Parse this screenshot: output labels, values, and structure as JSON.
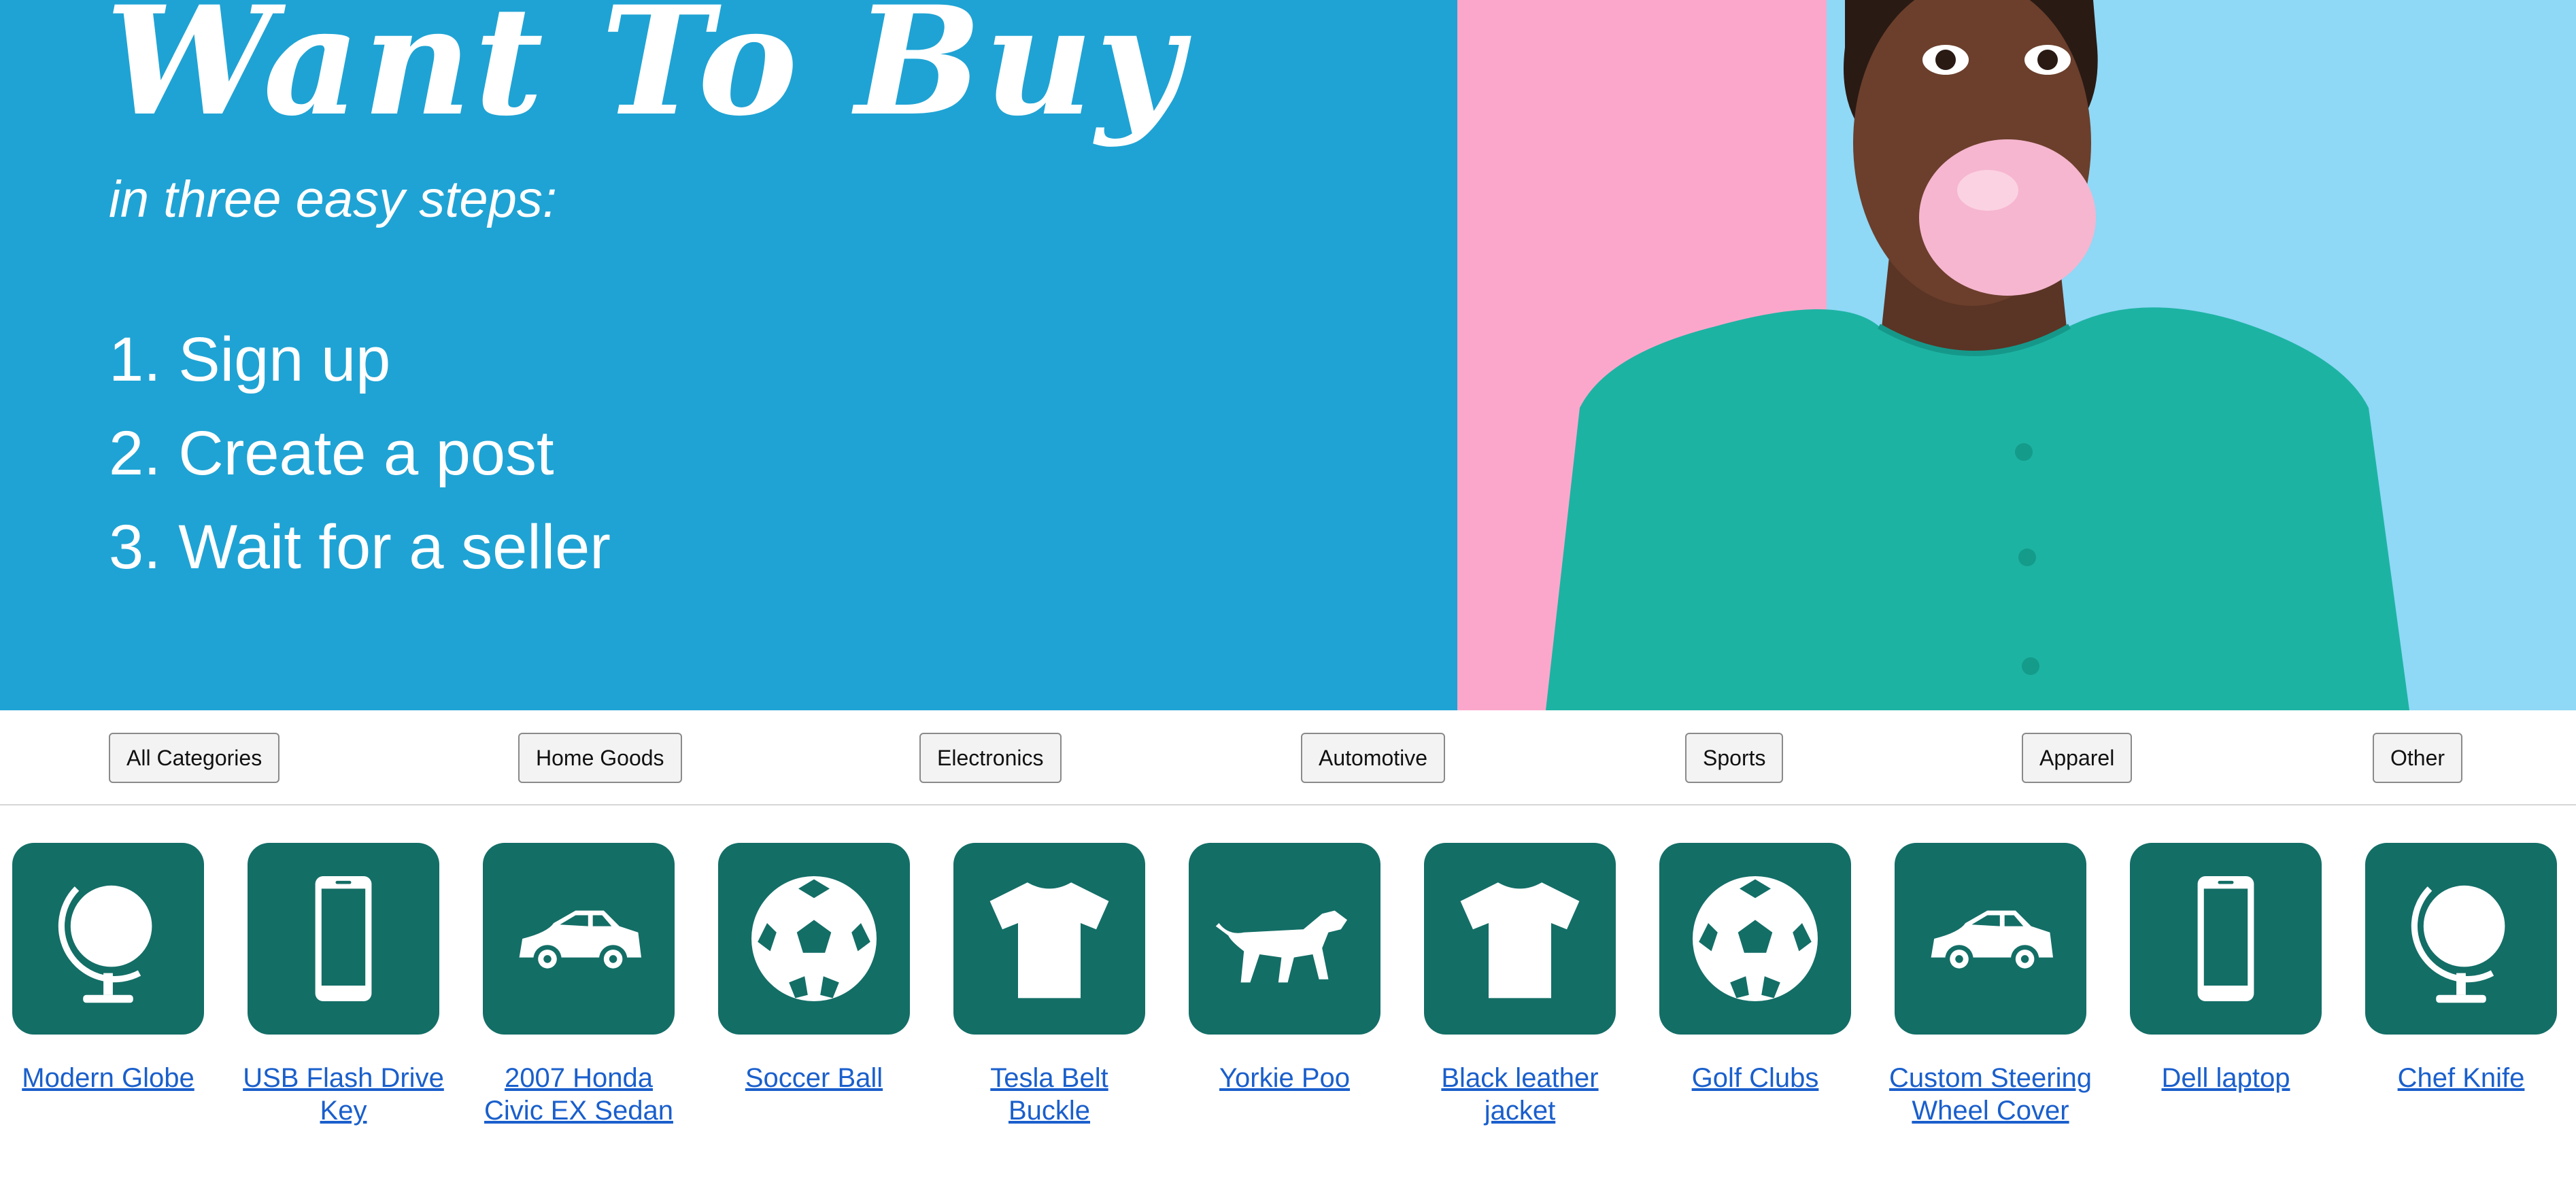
{
  "hero": {
    "title": "Want To Buy",
    "subtitle": "in three easy steps:",
    "steps": [
      "1.  Sign up",
      "2. Create a post",
      "3. Wait for a seller"
    ],
    "colors": {
      "left_bg": "#1fa3d4",
      "pink": "#fba7cb",
      "sky": "#8fd8f6",
      "cardigan": "#1db3a3"
    }
  },
  "categories": [
    "All Categories",
    "Home Goods",
    "Electronics",
    "Automotive",
    "Sports",
    "Apparel",
    "Other"
  ],
  "products": [
    {
      "icon": "globe-icon",
      "label": "Modern Globe"
    },
    {
      "icon": "phone-icon",
      "label": "USB Flash Drive Key"
    },
    {
      "icon": "car-icon",
      "label": "2007 Honda Civic EX Sedan"
    },
    {
      "icon": "soccer-ball-icon",
      "label": "Soccer Ball"
    },
    {
      "icon": "tshirt-icon",
      "label": "Tesla Belt Buckle"
    },
    {
      "icon": "dog-icon",
      "label": "Yorkie Poo"
    },
    {
      "icon": "tshirt-icon",
      "label": "Black leather jacket"
    },
    {
      "icon": "soccer-ball-icon",
      "label": "Golf Clubs"
    },
    {
      "icon": "car-icon",
      "label": "Custom Steering Wheel Cover"
    },
    {
      "icon": "phone-icon",
      "label": "Dell laptop"
    },
    {
      "icon": "globe-icon",
      "label": "Chef Knife"
    }
  ],
  "tile_color": "#136e66",
  "link_color": "#1a5fcc"
}
